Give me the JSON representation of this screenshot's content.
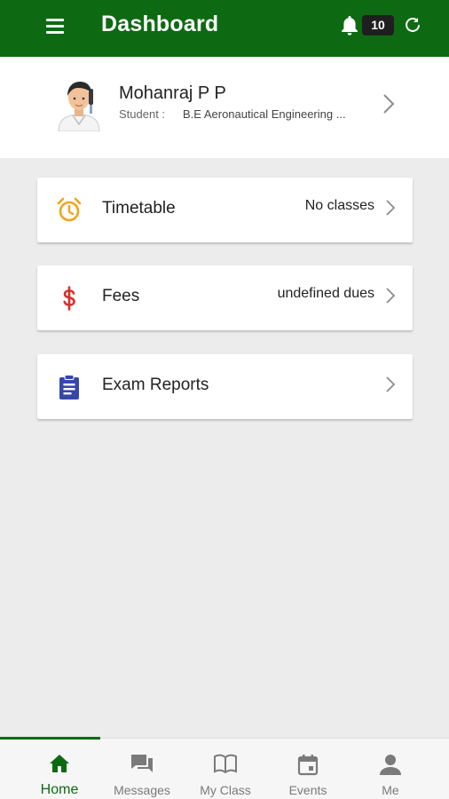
{
  "header": {
    "title": "Dashboard",
    "notification_count": "10"
  },
  "profile": {
    "name": "Mohanraj P P",
    "role_label": "Student :",
    "course": "B.E Aeronautical Engineering ..."
  },
  "cards": [
    {
      "label": "Timetable",
      "value": "No classes",
      "icon": "alarm-clock-icon",
      "icon_color": "#f2a31b"
    },
    {
      "label": "Fees",
      "value": "undefined dues",
      "icon": "dollar-icon",
      "icon_color": "#d9302c"
    },
    {
      "label": "Exam Reports",
      "value": "",
      "icon": "clipboard-icon",
      "icon_color": "#3747a8"
    }
  ],
  "bottom_nav": [
    {
      "label": "Home",
      "icon": "home-icon",
      "active": true
    },
    {
      "label": "Messages",
      "icon": "messages-icon"
    },
    {
      "label": "My Class",
      "icon": "book-icon"
    },
    {
      "label": "Events",
      "icon": "calendar-icon"
    },
    {
      "label": "Me",
      "icon": "person-icon"
    }
  ],
  "colors": {
    "primary": "#0e6a12",
    "background": "#ececec",
    "nav_inactive": "#7a7a7a"
  }
}
